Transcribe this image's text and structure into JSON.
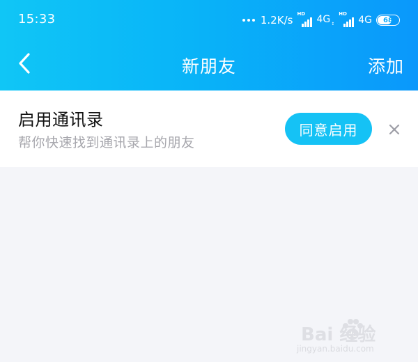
{
  "status_bar": {
    "time": "15:33",
    "net_speed": "1.2K/s",
    "sim1": {
      "hd": "HD",
      "network": "4G"
    },
    "sim2": {
      "hd": "HD",
      "network": "4G"
    },
    "battery": 68
  },
  "nav": {
    "back_icon": "chevron-left-icon",
    "title": "新朋友",
    "action_label": "添加"
  },
  "contacts_card": {
    "title": "启用通讯录",
    "subtitle": "帮你快速找到通讯录上的朋友",
    "agree_label": "同意启用",
    "close_icon": "close-icon"
  },
  "watermark": {
    "brand": "Bai  经验",
    "url": "jingyan.baidu.com"
  },
  "colors": {
    "header_gradient_start": "#10c6f6",
    "header_gradient_end": "#0a98fb",
    "button": "#15c2f5",
    "background": "#f4f5f9",
    "subtitle_gray": "#a7a7ad"
  }
}
